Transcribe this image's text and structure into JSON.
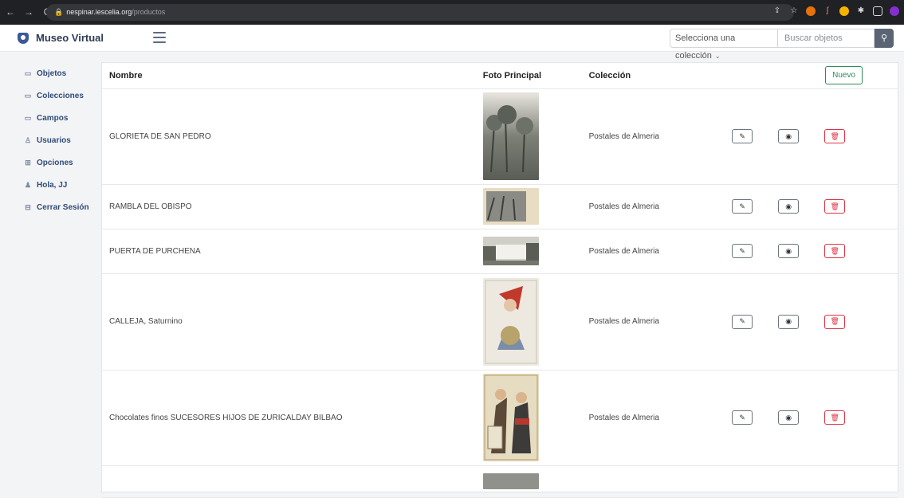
{
  "browser": {
    "url_host": "nespinar.iescelia.org",
    "url_path": "/productos"
  },
  "app": {
    "title": "Museo Virtual"
  },
  "search": {
    "select_label": "Selecciona una colección",
    "input_placeholder": "Buscar objetos"
  },
  "sidebar": {
    "items": [
      {
        "label": "Objetos",
        "icon": "folder-icon"
      },
      {
        "label": "Colecciones",
        "icon": "folder-icon"
      },
      {
        "label": "Campos",
        "icon": "folder-icon"
      },
      {
        "label": "Usuarios",
        "icon": "user-icon"
      },
      {
        "label": "Opciones",
        "icon": "grid-icon"
      },
      {
        "label": "Hola, JJ",
        "icon": "person-icon"
      },
      {
        "label": "Cerrar Sesión",
        "icon": "logout-icon"
      }
    ]
  },
  "table": {
    "headers": {
      "name": "Nombre",
      "foto": "Foto Principal",
      "coleccion": "Colección",
      "nuevo": "Nuevo"
    },
    "rows": [
      {
        "name": "GLORIETA DE SAN PEDRO",
        "coleccion": "Postales de Almeria"
      },
      {
        "name": "RAMBLA DEL OBISPO",
        "coleccion": "Postales de Almeria"
      },
      {
        "name": "PUERTA DE PURCHENA",
        "coleccion": "Postales de Almeria"
      },
      {
        "name": "CALLEJA, Saturnino",
        "coleccion": "Postales de Almeria"
      },
      {
        "name": "Chocolates finos SUCESORES HIJOS DE ZURICALDAY BILBAO",
        "coleccion": "Postales de Almeria"
      }
    ]
  },
  "colors": {
    "brand": "#2d3b55",
    "nuevo": "#2e8b57",
    "delete": "#dc3545"
  }
}
